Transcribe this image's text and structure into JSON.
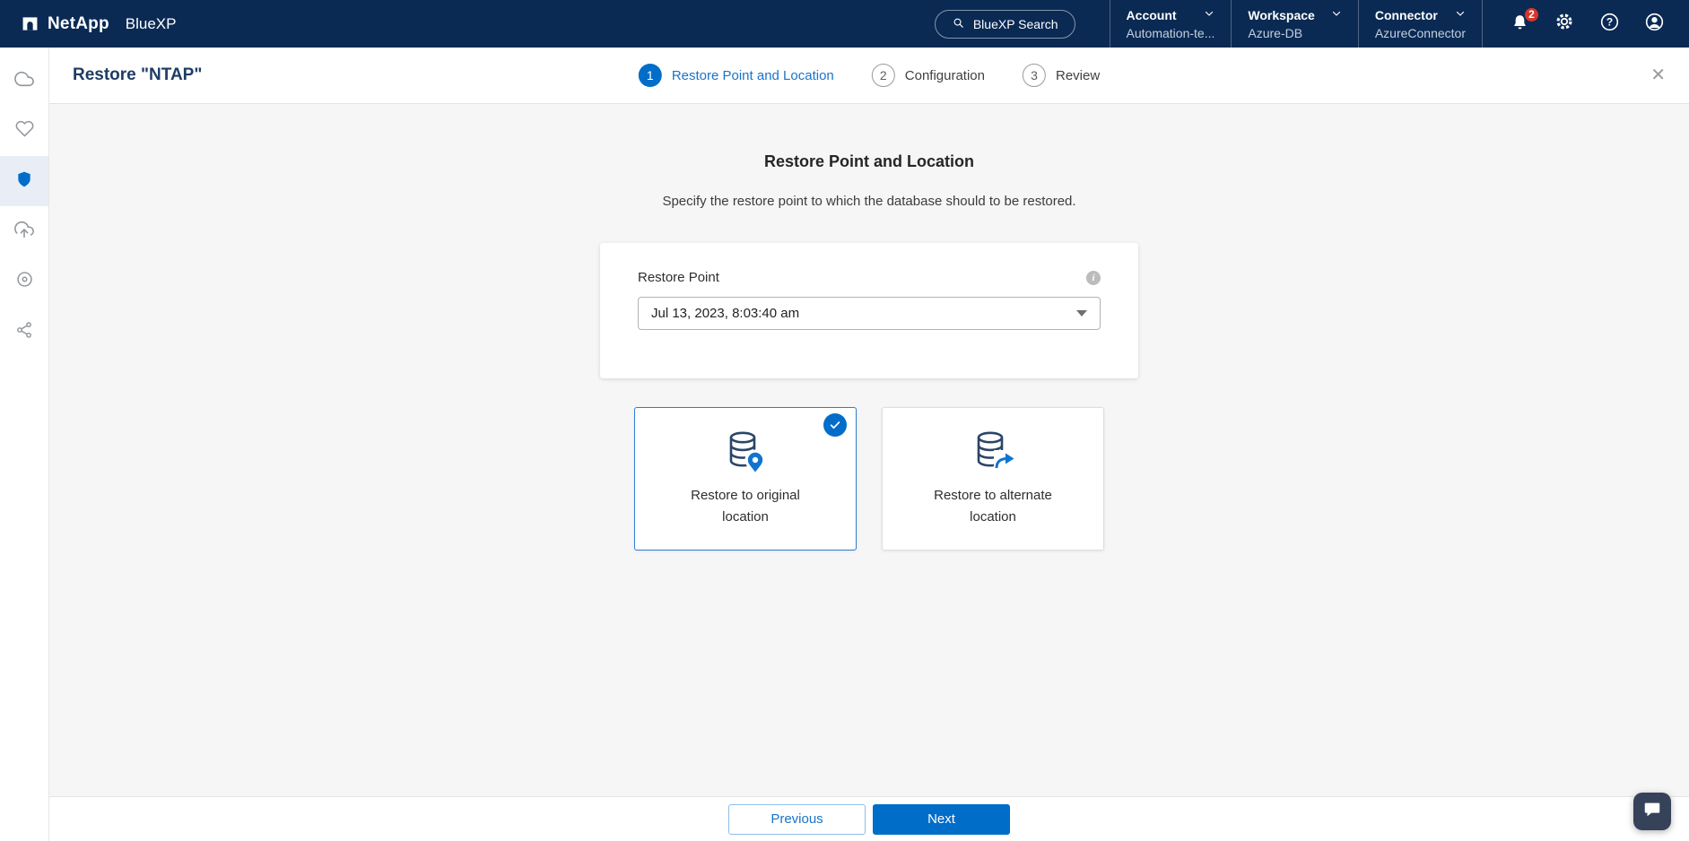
{
  "colors": {
    "accent": "#006dc9",
    "header_bg": "#0a2a54",
    "step_active_label": "#1a73c9",
    "content_bg": "#f6f6f7",
    "badge_red": "#d8352a"
  },
  "header": {
    "brand": "NetApp",
    "product": "BlueXP",
    "search_label": "BlueXP Search",
    "menus": [
      {
        "label": "Account",
        "value": "Automation-te..."
      },
      {
        "label": "Workspace",
        "value": "Azure-DB"
      },
      {
        "label": "Connector",
        "value": "AzureConnector"
      }
    ],
    "notification_count": "2"
  },
  "sidebar": {
    "items": [
      {
        "icon": "canvas-cloud-icon",
        "active": false
      },
      {
        "icon": "health-heart-icon",
        "active": false
      },
      {
        "icon": "protection-shield-icon",
        "active": true
      },
      {
        "icon": "backup-cloud-icon",
        "active": false
      },
      {
        "icon": "disc-icon",
        "active": false
      },
      {
        "icon": "share-nodes-icon",
        "active": false
      }
    ]
  },
  "page": {
    "title": "Restore \"NTAP\"",
    "close_icon": "✕",
    "steps": [
      {
        "num": "1",
        "label": "Restore Point and Location"
      },
      {
        "num": "2",
        "label": "Configuration"
      },
      {
        "num": "3",
        "label": "Review"
      }
    ]
  },
  "content": {
    "heading": "Restore Point and Location",
    "subheading": "Specify the restore point to which the database should to be restored.",
    "restore_point": {
      "label": "Restore Point",
      "value": "Jul 13, 2023, 8:03:40 am",
      "info_glyph": "i"
    },
    "options": [
      {
        "label": "Restore to original location",
        "selected": true
      },
      {
        "label": "Restore to alternate location",
        "selected": false
      }
    ]
  },
  "footer": {
    "previous_label": "Previous",
    "next_label": "Next"
  }
}
